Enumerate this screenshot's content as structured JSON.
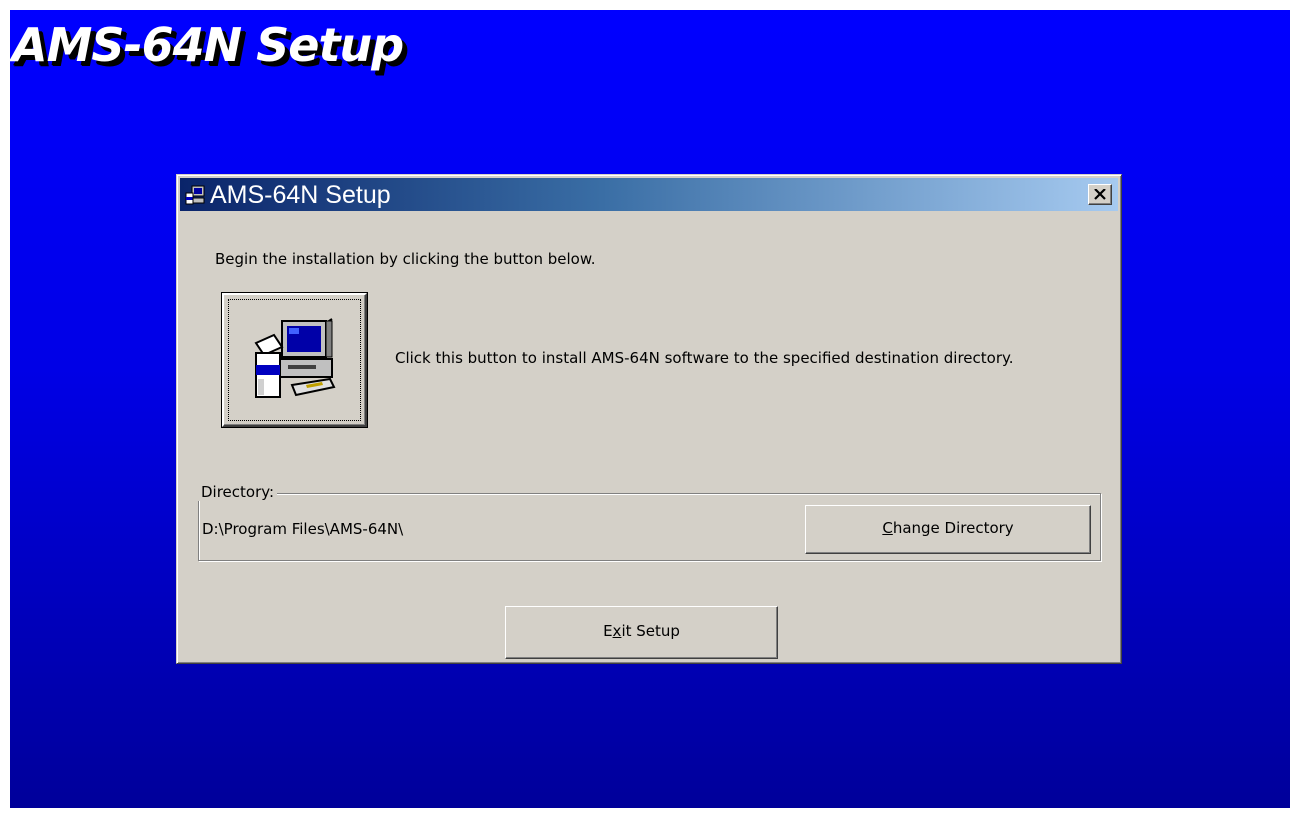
{
  "banner": {
    "title": "AMS-64N Setup"
  },
  "dialog": {
    "title": "AMS-64N Setup",
    "title_icon": "setup-app-icon",
    "close_label": "×",
    "intro_text": "Begin the installation by clicking the button below.",
    "install_button": {
      "icon": "computer-install-icon"
    },
    "install_description": "Click this button to install AMS-64N software to the specified destination directory.",
    "directory": {
      "legend": "Directory:",
      "path": "D:\\Program Files\\AMS-64N\\",
      "change_button": {
        "mnemonic": "C",
        "rest": "hange Directory"
      }
    },
    "exit_button": {
      "before": "E",
      "mnemonic": "x",
      "after": "it Setup"
    }
  },
  "colors": {
    "desktop_top": "#0000ff",
    "desktop_bottom": "#00009a",
    "titlebar_start": "#0a246a",
    "titlebar_end": "#a6caf0",
    "dialog_face": "#d4d0c8"
  }
}
